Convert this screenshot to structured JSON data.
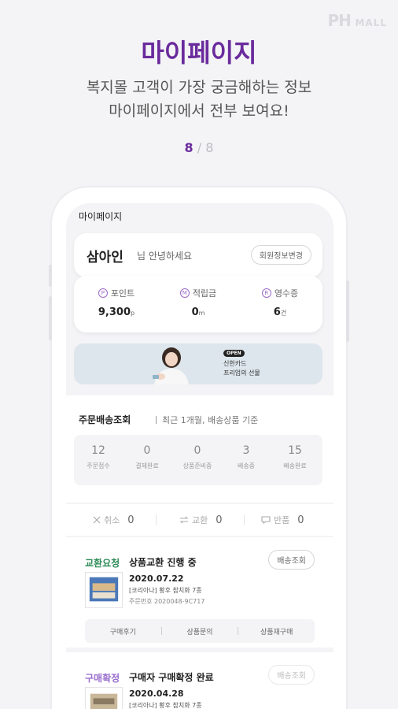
{
  "brand": {
    "logo_big": "PH",
    "logo_small": "MALL"
  },
  "headline": "마이페이지",
  "subtitle_line1": "복지몰 고객이 가장 궁금해하는 정보",
  "subtitle_line2": "마이페이지에서 전부 보여요!",
  "pager": {
    "current": "8",
    "sep": " / ",
    "total": "8"
  },
  "screen": {
    "title": "마이페이지",
    "user": {
      "name": "삼아인",
      "greeting": "님 안녕하세요",
      "edit_button": "회원정보변경"
    },
    "stats": [
      {
        "icon": "P",
        "label": "포인트",
        "value": "9,300",
        "unit": "p"
      },
      {
        "icon": "M",
        "label": "적립금",
        "value": "0",
        "unit": "m"
      },
      {
        "icon": "R",
        "label": "영수증",
        "value": "6",
        "unit": "건"
      }
    ],
    "banner": {
      "badge": "OPEN",
      "line1": "신한카드",
      "line2": "프리엄의 선물"
    },
    "orders": {
      "title": "주문배송조회",
      "subtitle": "최근 1개월, 배송상품 기준",
      "counts": [
        {
          "count": "12",
          "label": "주문접수"
        },
        {
          "count": "0",
          "label": "결제완료"
        },
        {
          "count": "0",
          "label": "상품준비중"
        },
        {
          "count": "3",
          "label": "배송중"
        },
        {
          "count": "15",
          "label": "배송완료"
        }
      ]
    },
    "claims": [
      {
        "icon": "x-icon",
        "label": "취소",
        "count": "0"
      },
      {
        "icon": "exchange-icon",
        "label": "교환",
        "count": "0"
      },
      {
        "icon": "return-icon",
        "label": "반품",
        "count": "0"
      }
    ],
    "items": [
      {
        "status": "교환요청",
        "status_color": "#2e8b57",
        "title": "상품교환 진행 중",
        "track_button": "배송조회",
        "date": "2020.07.22",
        "product": "[코리아나] 황후 참치화 7종",
        "order_no": "주문번호 2020048-9C717",
        "actions": [
          "구매후기",
          "상품문의",
          "상품재구매"
        ]
      },
      {
        "status": "구매확정",
        "status_color": "#9b6fd0",
        "title": "구매자 구매확정 완료",
        "track_button": "배송조회",
        "date": "2020.04.28",
        "product": "[코리아나] 황후 참치화 7종"
      }
    ]
  },
  "colors": {
    "accent": "#6a2b9c",
    "background": "#f4f4f6"
  }
}
